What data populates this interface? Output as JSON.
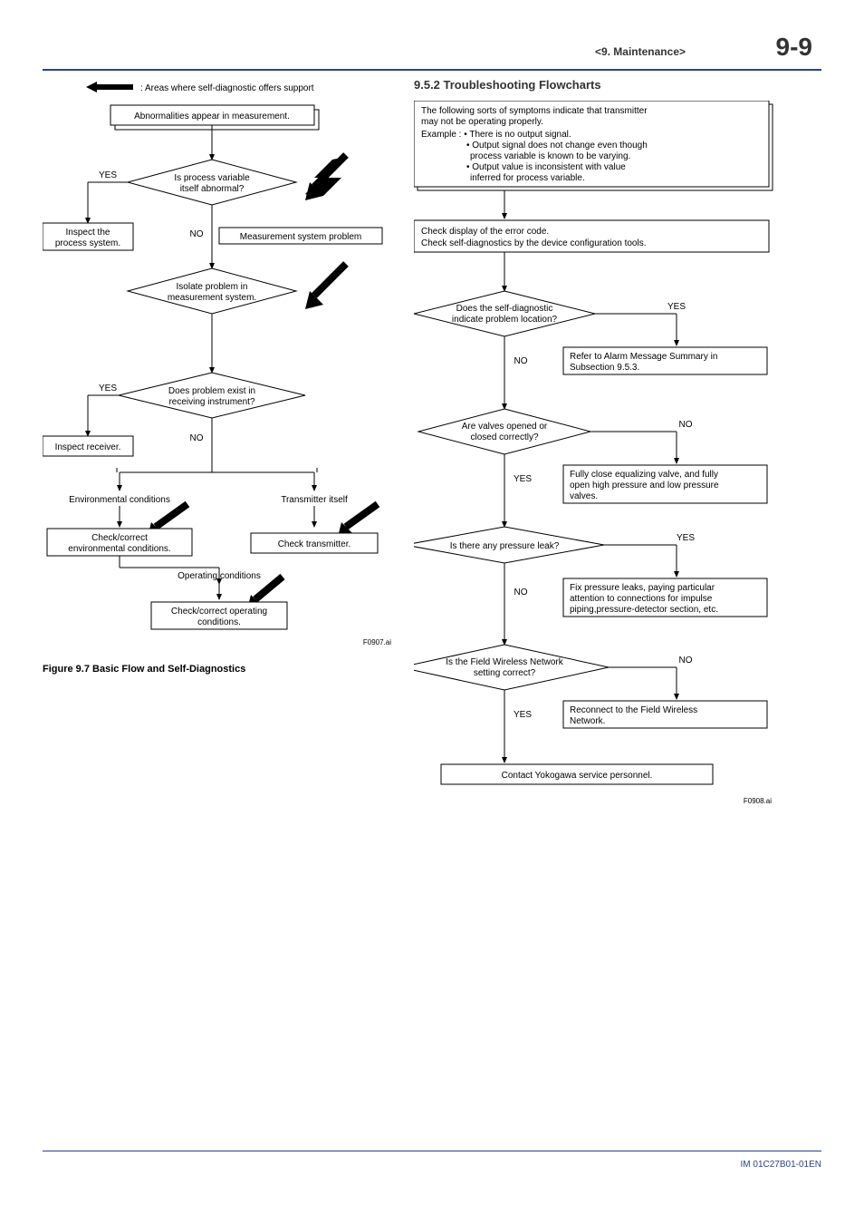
{
  "header": {
    "section": "<9.  Maintenance>",
    "page": "9-9"
  },
  "left": {
    "legend": ": Areas where self-diagnostic offers support",
    "start": "Abnormalities appear in measurement.",
    "d1": "Is process variable itself abnormal?",
    "yes1": "YES",
    "no1": "NO",
    "inspect_process": "Inspect the process system.",
    "msp": "Measurement system problem",
    "d2": "Isolate problem in measurement system.",
    "d3": "Does problem exist in receiving instrument?",
    "yes3": "YES",
    "no3": "NO",
    "inspect_receiver": "Inspect receiver.",
    "env_cond": "Environmental conditions",
    "trans_itself": "Transmitter itself",
    "check_env": "Check/correct environmental conditions.",
    "check_trans": "Check transmitter.",
    "op_cond": "Operating conditions",
    "check_op": "Check/correct operating conditions.",
    "fig_id": "F0907.ai",
    "caption": "Figure 9.7      Basic Flow and Self-Diagnostics"
  },
  "right": {
    "title": "9.5.2   Troubleshooting Flowcharts",
    "intro1": "The following sorts of symptoms indicate that transmitter may not be operating properly.",
    "intro2": "Example : • There is no output signal.",
    "intro3": "• Output signal does not change even though process variable is known to be varying.",
    "intro4": "• Output value is inconsistent with value inferred for process variable.",
    "check_display": "Check display of the error code.\nCheck self-diagnostics by the device configuration tools.",
    "d1": "Does the self-diagnostic indicate problem location?",
    "yes1": "YES",
    "no1": "NO",
    "refer_alarm": "Refer to Alarm Message Summary in Subsection 9.5.3.",
    "d2": "Are valves opened or closed correctly?",
    "no2": "NO",
    "yes2": "YES",
    "close_valve": "Fully close equalizing valve, and fully open high pressure and low pressure valves.",
    "d3": "Is there any pressure leak?",
    "yes3": "YES",
    "no3": "NO",
    "fix_leak": "Fix pressure leaks, paying particular attention to connections for impulse piping,pressure-detector section, etc.",
    "d4": "Is the Field Wireless Network setting correct?",
    "no4": "NO",
    "yes4": "YES",
    "reconnect": "Reconnect to the Field  Wireless Network.",
    "contact": "Contact Yokogawa service personnel.",
    "fig_id": "F0908.ai"
  },
  "footer": {
    "doc_id": "IM 01C27B01-01EN"
  }
}
